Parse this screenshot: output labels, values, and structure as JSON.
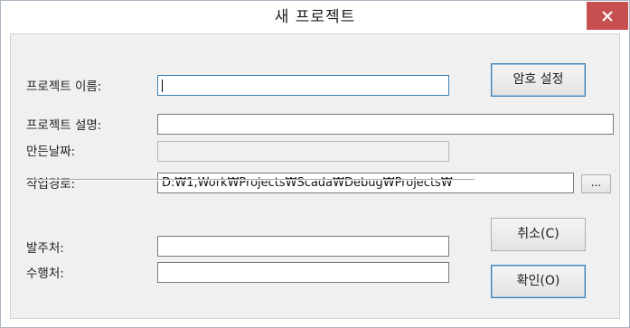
{
  "window": {
    "title": "새 프로젝트"
  },
  "icons": {
    "close": "close-icon"
  },
  "colors": {
    "close_button": "#c74f4f",
    "focus_border": "#3c7fb1"
  },
  "form": {
    "project_name": {
      "label": "프로젝트 이름:",
      "value": ""
    },
    "project_description": {
      "label": "프로젝트 설명:",
      "value": ""
    },
    "created_date": {
      "label": "만든날짜:",
      "value": ""
    },
    "work_path": {
      "label": "작업경로:",
      "value": "D:₩1,Work₩Projects₩Scada₩Debug₩Projects₩"
    },
    "client": {
      "label": "발주처:",
      "value": ""
    },
    "contractor": {
      "label": "수행처:",
      "value": ""
    }
  },
  "buttons": {
    "password": "암호 설정",
    "browse": "...",
    "cancel": "취소(C)",
    "ok": "확인(O)"
  }
}
